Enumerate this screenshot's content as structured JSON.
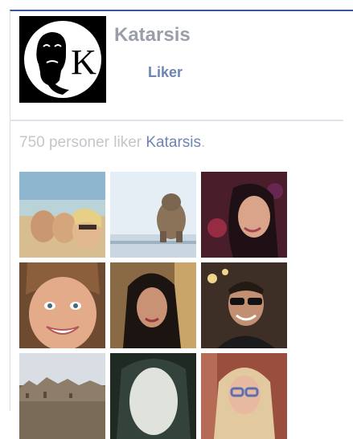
{
  "page": {
    "name": "Katarsis",
    "like_button_label": "Liker",
    "logo": {
      "letter": "K",
      "icon": "bearded-man-logo-icon"
    }
  },
  "likes": {
    "count_text": "750 personer liker",
    "page_name": "Katarsis",
    "suffix": "."
  },
  "faces": [
    {
      "icon": "friends-beach-selfie-photo"
    },
    {
      "icon": "dog-by-window-photo"
    },
    {
      "icon": "woman-dark-hair-photo"
    },
    {
      "icon": "smiling-woman-photo"
    },
    {
      "icon": "woman-long-dark-hair-photo"
    },
    {
      "icon": "man-sunglasses-photo"
    },
    {
      "icon": "city-skyline-photo"
    },
    {
      "icon": "woman-pale-face-photo"
    },
    {
      "icon": "woman-blonde-glasses-photo"
    }
  ],
  "colors": {
    "accent": "#3b5998",
    "link": "#6d84b4",
    "muted_text": "#c3c6cc"
  }
}
